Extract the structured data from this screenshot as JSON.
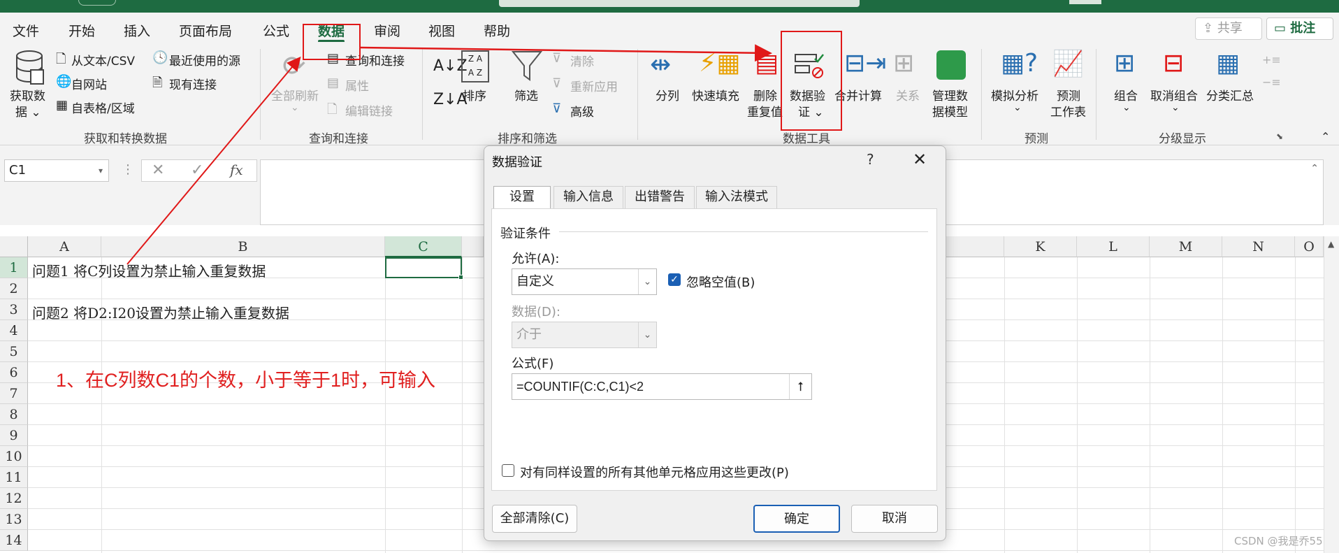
{
  "menu": {
    "items": [
      "文件",
      "开始",
      "插入",
      "页面布局",
      "公式",
      "数据",
      "审阅",
      "视图",
      "帮助"
    ],
    "active": "数据",
    "share_label": "共享",
    "comment_label": "批注"
  },
  "ribbon": {
    "get_data": {
      "label_1": "获取数",
      "label_2": "据"
    },
    "from_text_csv": "从文本/CSV",
    "from_web": "自网站",
    "from_table": "自表格/区域",
    "recent_sources": "最近使用的源",
    "existing_connections": "现有连接",
    "refresh_all": "全部刷新",
    "queries_connections": "查询和连接",
    "properties": "属性",
    "edit_links": "编辑链接",
    "sort": "排序",
    "filter": "筛选",
    "clear": "清除",
    "reapply": "重新应用",
    "advanced": "高级",
    "text_to_columns": "分列",
    "flash_fill": "快速填充",
    "remove_duplicates_1": "删除",
    "remove_duplicates_2": "重复值",
    "data_validation_1": "数据验",
    "data_validation_2": "证",
    "consolidate": "合并计算",
    "relationships": "关系",
    "data_model_1": "管理数",
    "data_model_2": "据模型",
    "what_if_1": "模拟分析",
    "forecast_1": "预测",
    "forecast_2": "工作表",
    "group": "组合",
    "ungroup": "取消组合",
    "subtotal": "分类汇总",
    "groups": {
      "get_transform": "获取和转换数据",
      "queries": "查询和连接",
      "sort_filter": "排序和筛选",
      "data_tools": "数据工具",
      "forecast": "预测",
      "outline": "分级显示"
    }
  },
  "formula_bar": {
    "name_box": "C1",
    "fx": "fx"
  },
  "sheet": {
    "columns": [
      "A",
      "B",
      "C",
      "K",
      "L",
      "M",
      "N",
      "O"
    ],
    "rows": [
      "1",
      "2",
      "3",
      "4",
      "5",
      "6",
      "7",
      "8",
      "9",
      "10",
      "11",
      "12",
      "13",
      "14"
    ],
    "a1": "问题1 将C列设置为禁止输入重复数据",
    "a3": "问题2 将D2:I20设置为禁止输入重复数据",
    "note": "1、在C列数C1的个数，小于等于1时，可输入"
  },
  "dialog": {
    "title": "数据验证",
    "help": "?",
    "close": "✕",
    "tabs": [
      "设置",
      "输入信息",
      "出错警告",
      "输入法模式"
    ],
    "section_title": "验证条件",
    "allow_label": "允许(A):",
    "allow_value": "自定义",
    "ignore_blank_label": "忽略空值(B)",
    "ignore_blank_checked": true,
    "data_label": "数据(D):",
    "data_value": "介于",
    "formula_label": "公式(F)",
    "formula_value": "=COUNTIF(C:C,C1)<2",
    "apply_all_label": "对有同样设置的所有其他单元格应用这些更改(P)",
    "clear_all": "全部清除(C)",
    "ok": "确定",
    "cancel": "取消"
  },
  "watermark": "CSDN @我是乔55",
  "colors": {
    "accent": "#1e6b41",
    "annotation": "#e01818",
    "dialog_primary": "#1a5fb4"
  }
}
